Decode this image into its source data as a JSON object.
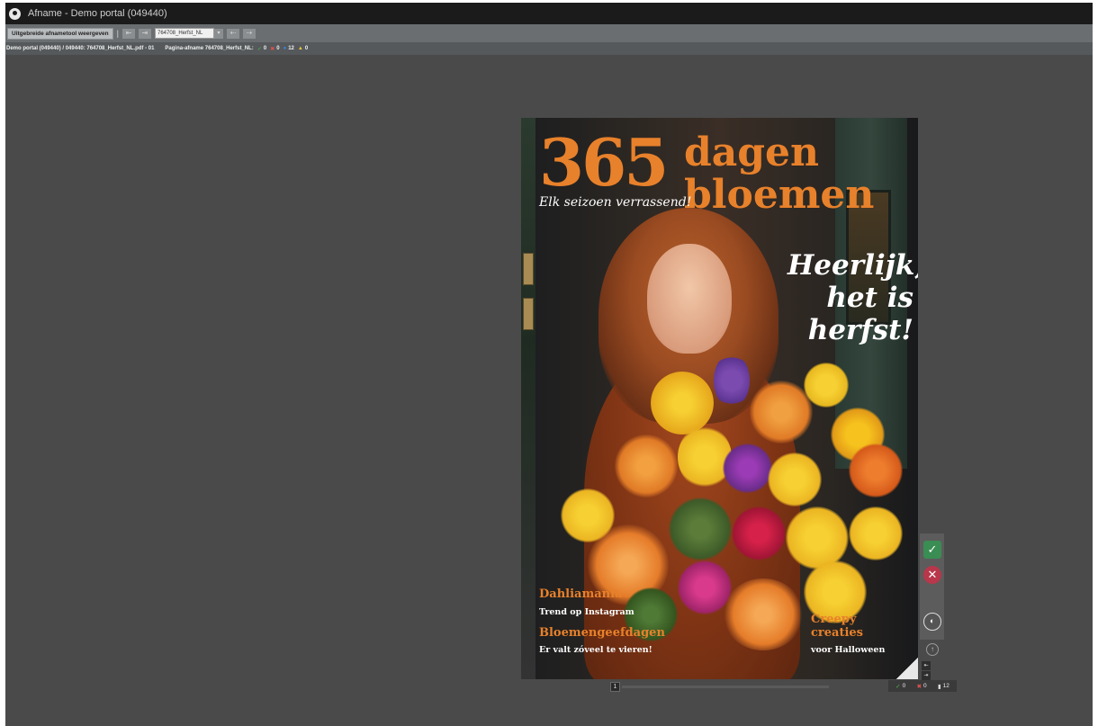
{
  "window": {
    "title": "Afname - Demo portal (049440)"
  },
  "toolbar": {
    "advanced_button": "Uitgebreide afnametool weergeven",
    "separator": "|",
    "prev_page": "⇤",
    "next_page": "⇥",
    "file_select_value": "764708_Herfst_NL",
    "dropdown_arrow": "▾",
    "back": "⇠",
    "forward": "⇢"
  },
  "infobar": {
    "path": "Demo portal (049440) / 049440: 764708_Herfst_NL.pdf - 01",
    "page_label": "Pagina-afname 764708_Herfst_NL:",
    "approved_count": "0",
    "rejected_count": "0",
    "comments_count": "12",
    "warnings_count": "0"
  },
  "magazine": {
    "number": "365",
    "word1": "dagen",
    "word2": "bloemen",
    "tagline": "Elk seizoen verrassend!",
    "script_line1": "Heerlijk,",
    "script_line2": "het is",
    "script_line3": "herfst!",
    "dahlia_title": "Dahliamania",
    "dahlia_sub": "Trend op Instagram",
    "bloemen_title": "Bloemengeefdagen",
    "bloemen_sub": "Er valt zóveel te vieren!",
    "creepy_title": "Creepy creaties",
    "creepy_sub": "voor Halloween"
  },
  "sidepanel": {
    "approve_icon": "✓",
    "reject_icon": "✕",
    "compare_icon": "◐",
    "up_icon": "↑",
    "nav_first": "⇤",
    "nav_last": "⇥"
  },
  "bottom": {
    "page_number": "1",
    "status_approved": "0",
    "status_rejected": "0",
    "status_comments": "12"
  },
  "colors": {
    "accent_orange": "#e8812b",
    "approve_green": "#3a8d53",
    "reject_red": "#b8374b",
    "background": "#4a4a4a"
  }
}
